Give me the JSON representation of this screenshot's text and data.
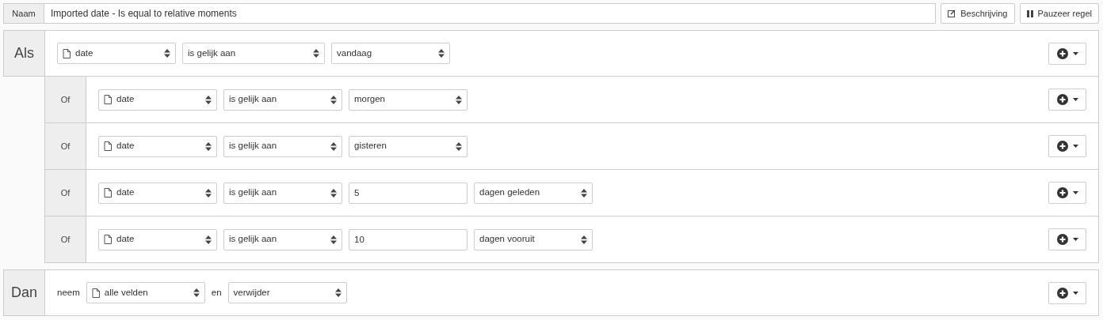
{
  "name_field": {
    "label": "Naam",
    "value": "Imported date - Is equal to relative moments"
  },
  "header_buttons": [
    {
      "label": "Beschrijving"
    },
    {
      "label": "Pauzeer regel"
    }
  ],
  "condition": {
    "label": "Als",
    "controls": [
      {
        "kind": "field",
        "value": "date"
      },
      {
        "kind": "select",
        "value": "is gelijk aan"
      },
      {
        "kind": "select",
        "value": "vandaag"
      }
    ]
  },
  "or_conditions": [
    {
      "label": "Of",
      "controls": [
        {
          "kind": "field",
          "value": "date"
        },
        {
          "kind": "select",
          "value": "is gelijk aan"
        },
        {
          "kind": "select",
          "value": "morgen"
        }
      ]
    },
    {
      "label": "Of",
      "controls": [
        {
          "kind": "field",
          "value": "date"
        },
        {
          "kind": "select",
          "value": "is gelijk aan"
        },
        {
          "kind": "select",
          "value": "gisteren"
        }
      ]
    },
    {
      "label": "Of",
      "controls": [
        {
          "kind": "field",
          "value": "date"
        },
        {
          "kind": "select",
          "value": "is gelijk aan"
        },
        {
          "kind": "input",
          "value": "5"
        },
        {
          "kind": "select",
          "value": "dagen geleden"
        }
      ]
    },
    {
      "label": "Of",
      "controls": [
        {
          "kind": "field",
          "value": "date"
        },
        {
          "kind": "select",
          "value": "is gelijk aan"
        },
        {
          "kind": "input",
          "value": "10"
        },
        {
          "kind": "select",
          "value": "dagen vooruit"
        }
      ]
    }
  ],
  "action": {
    "label": "Dan",
    "controls": [
      {
        "kind": "text",
        "value": "neem"
      },
      {
        "kind": "field",
        "value": "alle velden"
      },
      {
        "kind": "text",
        "value": "en"
      },
      {
        "kind": "select",
        "value": "verwijder"
      }
    ]
  }
}
